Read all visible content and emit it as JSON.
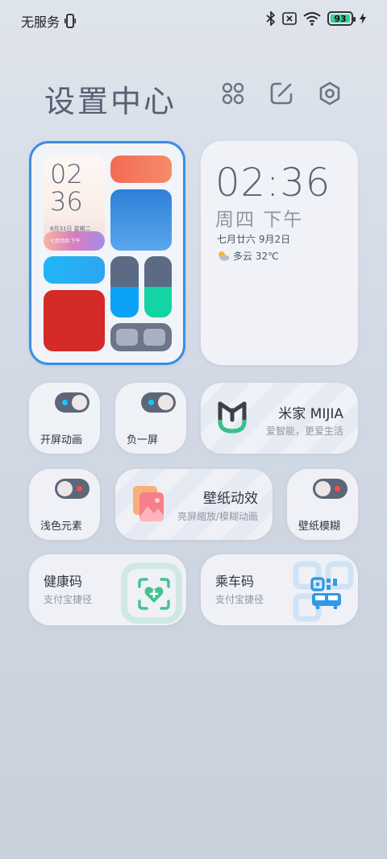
{
  "status": {
    "carrier": "无服务",
    "battery": "93"
  },
  "header": {
    "title": "设置中心",
    "icons": [
      "link-icon",
      "edit-icon",
      "settings-hexagon-icon"
    ]
  },
  "layout_widget": {
    "time_top": "02",
    "time_bottom": "36",
    "date": "8月31日 星期二",
    "lunar": "七月廿四 下午"
  },
  "time_widget": {
    "time": "02:36",
    "day": "周四 下午",
    "date": "七月廿六 9月2日",
    "weather": "多云 32℃"
  },
  "toggles": {
    "boot_anim": "开屏动画",
    "minus_one": "负一屏",
    "light_elem": "浅色元素",
    "wallpaper_blur": "壁纸模糊"
  },
  "mijia": {
    "title": "米家 MIJIA",
    "subtitle": "爱智能，更爱生活"
  },
  "wallpaper": {
    "title": "壁纸动效",
    "subtitle": "亮屏缩放/模糊动画"
  },
  "health_code": {
    "title": "健康码",
    "subtitle": "支付宝捷径"
  },
  "ride_code": {
    "title": "乘车码",
    "subtitle": "支付宝捷径"
  },
  "colors": {
    "accent": "#3a8fe6",
    "mijia_green": "#36c28a",
    "health_green": "#43c28e",
    "ride_blue": "#2f9ae8"
  }
}
